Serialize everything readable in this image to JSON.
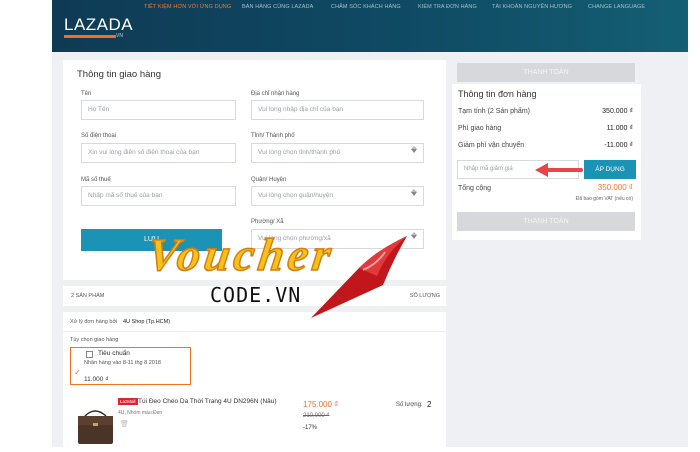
{
  "header": {
    "logo_text": "LAZADA",
    "logo_sub": "VN",
    "nav": [
      "TIẾT KIỆM HƠN VỚI ỨNG DỤNG",
      "BÁN HÀNG CÙNG LAZADA",
      "CHĂM SÓC KHÁCH HÀNG",
      "KIỂM TRA ĐƠN HÀNG",
      "TÀI KHOẢN NGUYỄN HƯƠNG",
      "CHANGE LANGUAGE"
    ]
  },
  "shipping": {
    "title": "Thông tin giao hàng",
    "name_label": "Tên",
    "name_placeholder": "Họ Tên",
    "phone_label": "Số điện thoại",
    "phone_placeholder": "Xin vui lòng điền số điện thoại của bạn",
    "tax_label": "Mã số thuế",
    "tax_placeholder": "Nhập mã số thuế của bạn",
    "address_label": "Địa chỉ nhận hàng",
    "address_placeholder": "Vui lòng nhập địa chỉ của bạn",
    "province_label": "Tỉnh/ Thành phố",
    "province_placeholder": "Vui lòng chọn tỉnh/thành phố",
    "district_label": "Quận/ Huyện",
    "district_placeholder": "Vui lòng chọn quận/huyện",
    "ward_label": "Phường/ Xã",
    "ward_placeholder": "Vui lòng chọn phường/xã",
    "save_button": "LƯU"
  },
  "cart": {
    "count_label": "2 SẢN PHẨM",
    "qty_header": "SỐ LƯỢNG",
    "seller_prefix": "Xử lý đơn hàng bởi",
    "seller_name": "4U Shop (Tp.HCM)",
    "delivery_choice_label": "Tùy chọn giao hàng",
    "delivery_option_name": "Tiêu chuẩn",
    "delivery_option_date": "Nhận hàng vào 8-11 thg 8 2018",
    "delivery_option_price": "11.000 ₫",
    "product_badge": "LazMall",
    "product_name": "Túi Đeo Chéo Da Thời Trang 4U DN296N (Nâu)",
    "product_variant": "4U, Nhóm màu:Đen",
    "product_price": "175.000 ₫",
    "product_old_price": "210.000 ₫",
    "product_discount": "-17%",
    "qty_label": "Số lượng:",
    "qty_value": "2"
  },
  "summary": {
    "checkout_top": "THANH TOÁN",
    "title": "Thông tin đơn hàng",
    "subtotal_label": "Tạm tính (2 Sản phẩm)",
    "subtotal_value": "350.000 ₫",
    "shipping_label": "Phí giao hàng",
    "shipping_value": "11.000 ₫",
    "ship_discount_label": "Giảm phí vận chuyển",
    "ship_discount_value": "-11.000 ₫",
    "voucher_placeholder": "Nhập mã giảm giá",
    "apply_button": "ÁP DỤNG",
    "total_label": "Tổng cộng",
    "total_value": "350.000 ₫",
    "vat_note": "Đã bao gồm VAT (nếu có)",
    "checkout_bottom": "THANH TOÁN"
  },
  "watermark": {
    "word": "Voucher",
    "domain": "CODE.VN"
  },
  "colors": {
    "accent_orange": "#f57224",
    "teal": "#1b93b5",
    "header_navy": "#0f3a55",
    "arrow_red": "#e8454a"
  }
}
